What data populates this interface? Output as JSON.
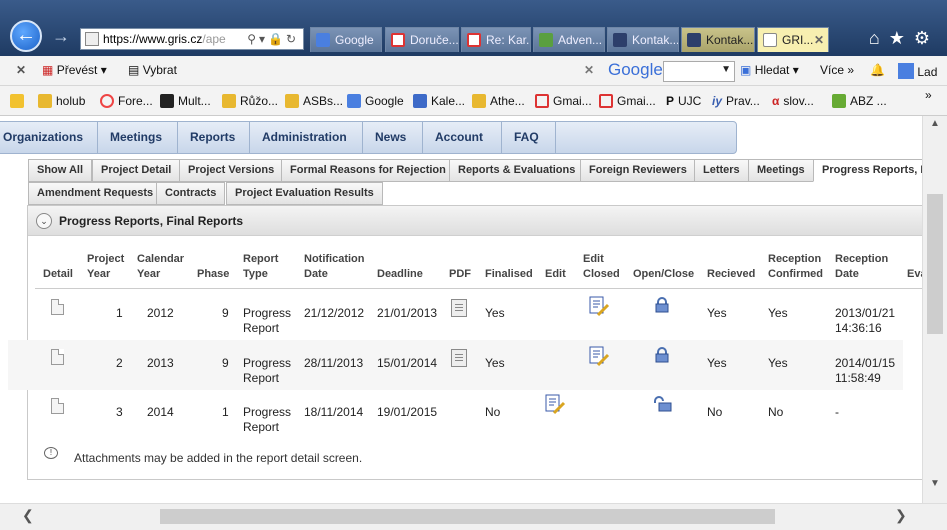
{
  "browser": {
    "url_main": "https://www.gris.cz",
    "url_dim": "/ape",
    "tabs": [
      {
        "label": "Google"
      },
      {
        "label": "Doruče..."
      },
      {
        "label": "Re: Kar..."
      },
      {
        "label": "Adven..."
      },
      {
        "label": "Kontak..."
      },
      {
        "label": "Kontak..."
      },
      {
        "label": "GRI..."
      }
    ],
    "command_bar": {
      "prevest": "Převést",
      "vybrat": "Vybrat",
      "google": "Google",
      "hledat": "Hledat",
      "vice": "Více",
      "user": "Lad"
    },
    "favorites": [
      "holub",
      "Fore...",
      "Mult...",
      "Růžo...",
      "ASBs...",
      "Google",
      "Kale...",
      "Athe...",
      "Gmai...",
      "Gmai...",
      "UJC",
      "Prav...",
      "slov...",
      "ABZ ..."
    ]
  },
  "site_nav": [
    "Organizations",
    "Meetings",
    "Reports",
    "Administration",
    "News",
    "Account",
    "FAQ"
  ],
  "sub_tabs_row1": [
    "Show All",
    "Project Detail",
    "Project Versions",
    "Formal Reasons for Rejection",
    "Reports & Evaluations",
    "Foreign Reviewers",
    "Letters",
    "Meetings",
    "Progress Reports, F"
  ],
  "sub_tabs_row2": [
    "Amendment Requests",
    "Contracts",
    "Project Evaluation Results"
  ],
  "panel": {
    "title": "Progress Reports, Final Reports",
    "headers": {
      "detail": "Detail",
      "project_year_1": "Project",
      "project_year_2": "Year",
      "calendar_year_1": "Calendar",
      "calendar_year_2": "Year",
      "phase": "Phase",
      "report_type_1": "Report",
      "report_type_2": "Type",
      "notification_1": "Notification",
      "notification_2": "Date",
      "deadline": "Deadline",
      "pdf": "PDF",
      "finalised": "Finalised",
      "edit": "Edit",
      "edit_closed_1": "Edit",
      "edit_closed_2": "Closed",
      "open_close": "Open/Close",
      "recieved": "Recieved",
      "reception_confirmed_1": "Reception",
      "reception_confirmed_2": "Confirmed",
      "reception_date_1": "Reception",
      "reception_date_2": "Date",
      "evaluation": "Eva"
    },
    "rows": [
      {
        "project_year": "1",
        "calendar_year": "2012",
        "phase": "9",
        "type_1": "Progress",
        "type_2": "Report",
        "notification": "21/12/2012",
        "deadline": "21/01/2013",
        "finalised": "Yes",
        "recieved": "Yes",
        "confirmed": "Yes",
        "reception_date_1": "2013/01/21",
        "reception_date_2": "14:36:16"
      },
      {
        "project_year": "2",
        "calendar_year": "2013",
        "phase": "9",
        "type_1": "Progress",
        "type_2": "Report",
        "notification": "28/11/2013",
        "deadline": "15/01/2014",
        "finalised": "Yes",
        "recieved": "Yes",
        "confirmed": "Yes",
        "reception_date_1": "2014/01/15",
        "reception_date_2": "11:58:49"
      },
      {
        "project_year": "3",
        "calendar_year": "2014",
        "phase": "1",
        "type_1": "Progress",
        "type_2": "Report",
        "notification": "18/11/2014",
        "deadline": "19/01/2015",
        "finalised": "No",
        "recieved": "No",
        "confirmed": "No",
        "reception_date_1": "-",
        "reception_date_2": ""
      }
    ],
    "note": "Attachments may be added in the report detail screen."
  }
}
